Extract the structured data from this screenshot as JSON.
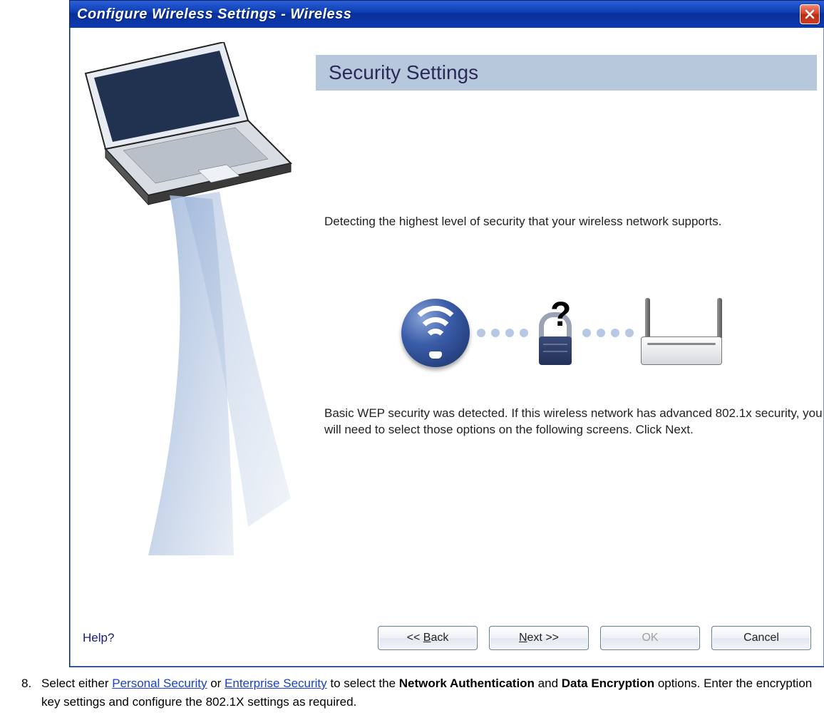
{
  "window": {
    "title": "Configure Wireless Settings  -  Wireless"
  },
  "header": {
    "title": "Security Settings"
  },
  "content": {
    "detecting": "Detecting the highest level of security that your wireless network supports.",
    "result": "Basic WEP security was detected. If this wireless network has advanced 802.1x security, you will need to select those options on the following screens. Click Next."
  },
  "buttons": {
    "help": "Help?",
    "back": "<<  Back",
    "next": "Next >>",
    "ok": "OK",
    "cancel": "Cancel"
  },
  "instruction": {
    "number": "8.",
    "prefix": "Select either ",
    "link1": "Personal Security",
    "mid1": " or ",
    "link2": "Enterprise Security",
    "mid2": " to select the ",
    "bold1": "Network Authentication",
    "mid3": " and ",
    "bold2": "Data Encryption",
    "suffix": " options. Enter the encryption key settings and configure the 802.1X settings as required."
  }
}
